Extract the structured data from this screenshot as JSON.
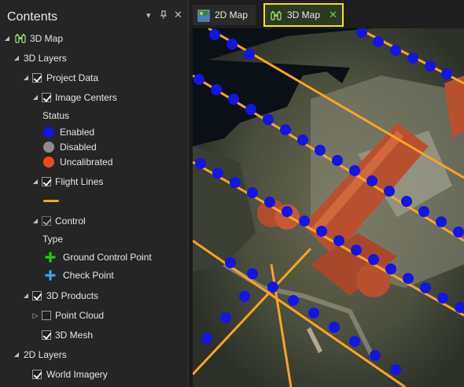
{
  "contents": {
    "title": "Contents",
    "pin_glyph": "▾",
    "autohide_glyph": "⊓",
    "close_glyph": "✕"
  },
  "tree": {
    "map_3d": "3D Map",
    "layers_3d": "3D Layers",
    "project_data": "Project Data",
    "image_centers": "Image Centers",
    "status_heading": "Status",
    "status_enabled": "Enabled",
    "status_disabled": "Disabled",
    "status_uncalibrated": "Uncalibrated",
    "flight_lines": "Flight Lines",
    "control": "Control",
    "type_heading": "Type",
    "gcp": "Ground Control Point",
    "check_point": "Check Point",
    "products_3d": "3D Products",
    "point_cloud": "Point Cloud",
    "mesh_3d": "3D Mesh",
    "layers_2d": "2D Layers",
    "world_imagery": "World Imagery"
  },
  "tabs": {
    "tab_2d": "2D Map",
    "tab_3d": "3D Map",
    "close_glyph": "✕"
  },
  "colors": {
    "enabled": "#1414e6",
    "disabled": "#8c8c8c",
    "uncalibrated": "#f0481e",
    "flight_line": "#f5a623",
    "gcp": "#1fd11f",
    "check_point": "#4fa3e0",
    "active_tab_outline": "#f2e11d"
  },
  "icons": {
    "pane_controls": [
      "chevron-down-icon",
      "pin-icon",
      "close-icon"
    ],
    "map_icon": "binoculars-map-icon",
    "tab_2d_icon": "2d-map-icon"
  }
}
